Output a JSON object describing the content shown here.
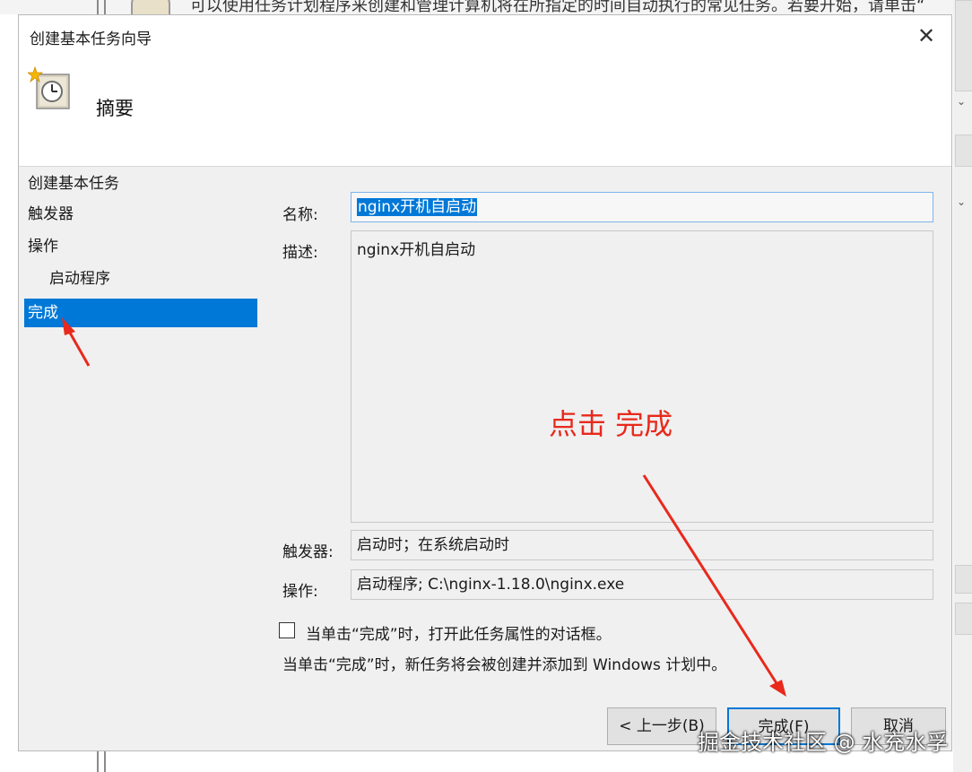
{
  "background_window": {
    "top_text": "可以使用任务计划程序来创建和管理计算机将在所指定的时间自动执行的常见任务。若要开始，请单击“"
  },
  "dialog": {
    "title": "创建基本任务向导",
    "close_label": "✕",
    "header_title": "摘要"
  },
  "nav": {
    "items": [
      {
        "label": "创建基本任务"
      },
      {
        "label": "触发器"
      },
      {
        "label": "操作"
      },
      {
        "label": "启动程序"
      },
      {
        "label": "完成"
      }
    ]
  },
  "form": {
    "name_label": "名称:",
    "name_value": "nginx开机自启动",
    "desc_label": "描述:",
    "desc_value": "nginx开机自启动",
    "trigger_label": "触发器:",
    "trigger_value": "启动时；在系统启动时",
    "action_label": "操作:",
    "action_value": "启动程序; C:\\nginx-1.18.0\\nginx.exe",
    "checkbox_label": "当单击“完成”时，打开此任务属性的对话框。",
    "checkbox_checked": false,
    "note": "当单击“完成”时，新任务将会被创建并添加到 Windows 计划中。"
  },
  "buttons": {
    "back": "< 上一步(B)",
    "finish": "完成(F)",
    "cancel": "取消"
  },
  "annotation": {
    "text": "点击 完成",
    "color": "#e8291c"
  },
  "watermark": "掘金技术社区 @ 水充水孚",
  "colors": {
    "selection": "#0078d7",
    "dialog_bg": "#f0f0f0"
  }
}
